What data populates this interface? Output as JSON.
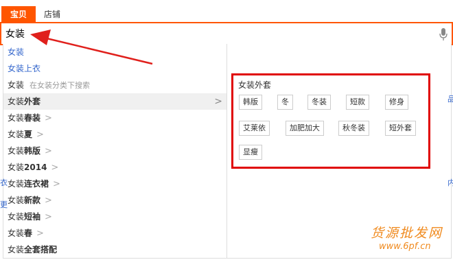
{
  "tabs": [
    {
      "label": "宝贝",
      "active": true
    },
    {
      "label": "店铺",
      "active": false
    }
  ],
  "search": {
    "value": "女装"
  },
  "suggestions": [
    {
      "text": "女装",
      "style": "blue"
    },
    {
      "text": "女装上衣",
      "style": "blue"
    },
    {
      "prefix": "女装",
      "hint": "在女装分类下搜索"
    },
    {
      "prefix": "女装",
      "bold": "外套",
      "expanded": true
    },
    {
      "prefix": "女装",
      "bold": "春装"
    },
    {
      "prefix": "女装",
      "bold": "夏"
    },
    {
      "prefix": "女装",
      "bold": "韩版"
    },
    {
      "prefix": "女装",
      "bold": "2014"
    },
    {
      "prefix": "女装",
      "bold": "连衣裙"
    },
    {
      "prefix": "女装",
      "bold": "新款"
    },
    {
      "prefix": "女装",
      "bold": "短袖"
    },
    {
      "prefix": "女装",
      "bold": "春"
    },
    {
      "prefix": "女装",
      "bold": "全套搭配"
    }
  ],
  "chevron": ">",
  "subcategory": {
    "title": "女装外套",
    "keywords": [
      "韩版",
      "冬",
      "冬装",
      "短款",
      "修身",
      "艾莱依",
      "加肥加大",
      "秋冬装",
      "短外套",
      "显瘦"
    ]
  },
  "edge_fragments": [
    "品",
    "内",
    "衣",
    "更"
  ],
  "watermark": {
    "chinese": "货源批发网",
    "url": "www.6pf.cn"
  },
  "colors": {
    "accent": "#ff5500",
    "link": "#3366cc",
    "highlight_box": "#e00000",
    "watermark": "#f08a1e"
  }
}
